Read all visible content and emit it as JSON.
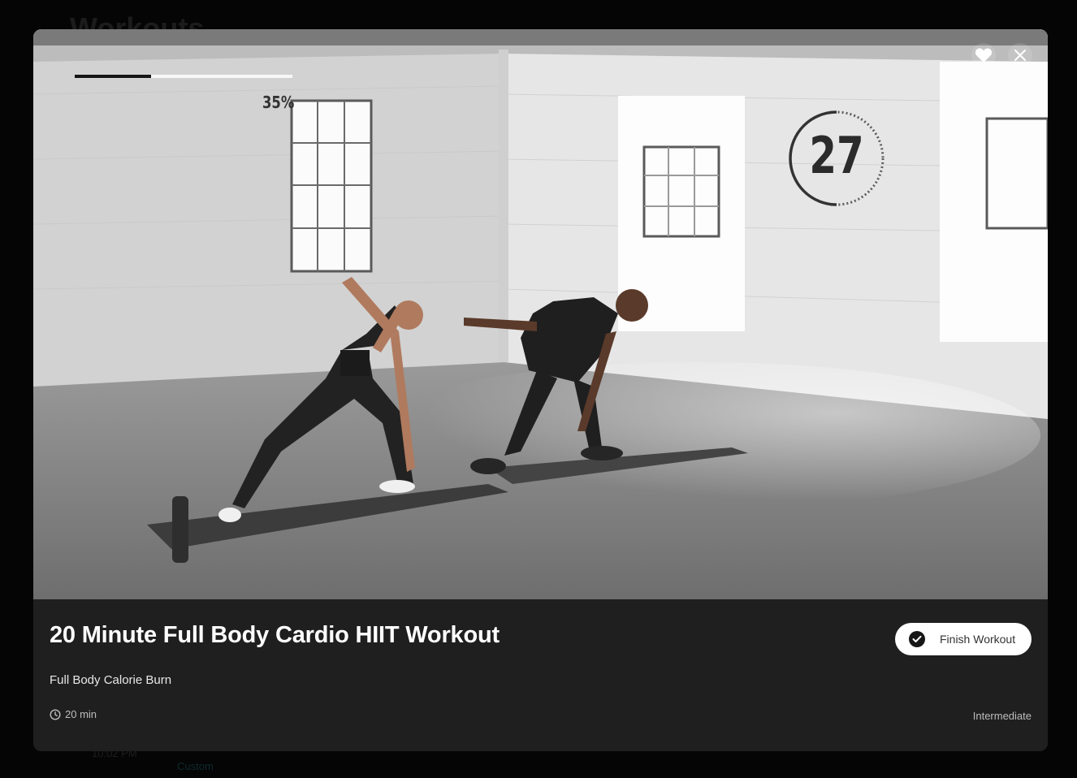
{
  "background": {
    "page_title": "Workouts",
    "time": "10:02 PM",
    "custom_label": "Custom"
  },
  "player": {
    "progress_percent": 35,
    "progress_label": "35%",
    "timer_value": "27",
    "timer_remaining_fraction": 0.5,
    "favorite_icon": "heart-icon",
    "close_icon": "close-icon"
  },
  "workout": {
    "title": "20 Minute Full Body Cardio HIIT Workout",
    "subtitle": "Full Body Calorie Burn",
    "duration": "20 min",
    "level": "Intermediate",
    "finish_label": "Finish Workout"
  },
  "colors": {
    "overlay": "#050505",
    "panel": "#1f1f1f",
    "button": "#ffffff"
  }
}
